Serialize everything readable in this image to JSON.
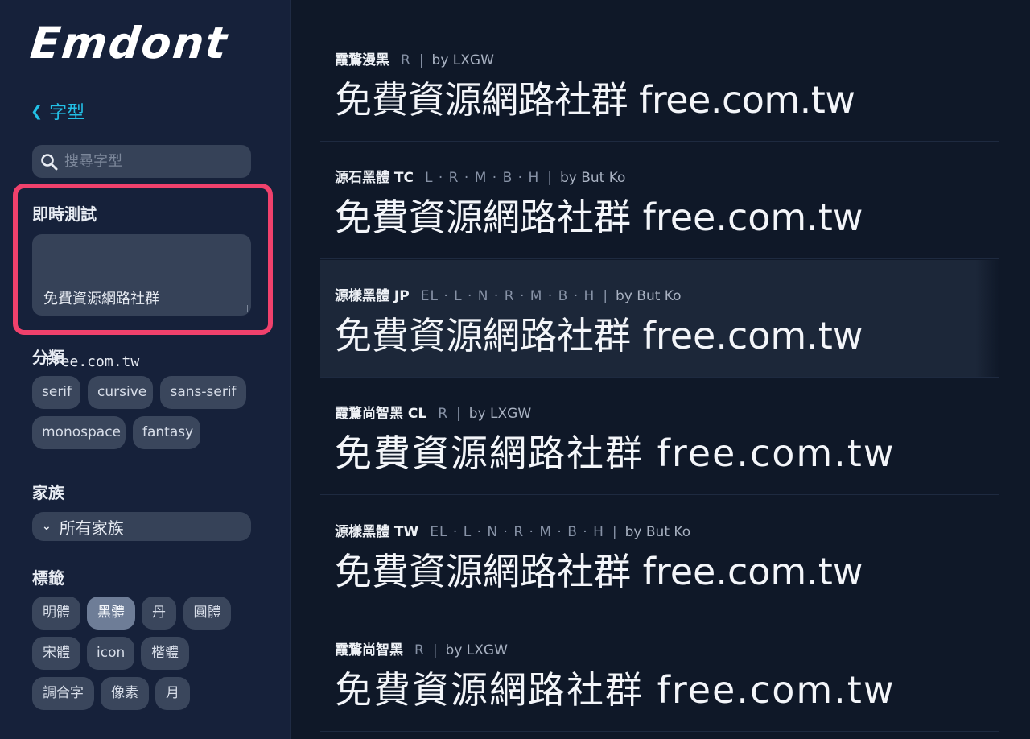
{
  "logo": "Emdont",
  "nav": {
    "back_label": "字型"
  },
  "search": {
    "placeholder": "搜尋字型"
  },
  "live_test": {
    "title": "即時測試",
    "line1": "免費資源網路社群",
    "line2": "free.com.tw"
  },
  "categories": {
    "title": "分類",
    "items": [
      "serif",
      "cursive",
      "sans-serif",
      "monospace",
      "fantasy"
    ]
  },
  "family": {
    "title": "家族",
    "selected": "所有家族"
  },
  "tags": {
    "title": "標籤",
    "items": [
      "明體",
      "黑體",
      "丹",
      "圓體",
      "宋體",
      "icon",
      "楷體",
      "調合字",
      "像素",
      "月"
    ],
    "active": "黑體"
  },
  "fonts": [
    {
      "name": "霞鶩漫黑",
      "weights": "R",
      "by": "by LXGW",
      "preview": "免費資源網路社群 free.com.tw"
    },
    {
      "name": "源石黑體 TC",
      "weights": "L · R · M · B · H",
      "by": "by But Ko",
      "preview": "免費資源網路社群 free.com.tw"
    },
    {
      "name": "源樣黑體 JP",
      "weights": "EL · L · N · R · M · B · H",
      "by": "by But Ko",
      "preview": "免費資源網路社群 free.com.tw"
    },
    {
      "name": "霞鶩尚智黑 CL",
      "weights": "R",
      "by": "by LXGW",
      "preview": "免費資源網路社群 free.com.tw"
    },
    {
      "name": "源樣黑體 TW",
      "weights": "EL · L · N · R · M · B · H",
      "by": "by But Ko",
      "preview": "免費資源網路社群 free.com.tw"
    },
    {
      "name": "霞鶩尚智黑",
      "weights": "R",
      "by": "by LXGW",
      "preview": "免費資源網路社群 free.com.tw"
    }
  ],
  "colors": {
    "accent": "#22c0e6",
    "highlight_border": "#f0416c",
    "sidebar_bg": "#16213a",
    "main_bg": "#0f1828"
  }
}
